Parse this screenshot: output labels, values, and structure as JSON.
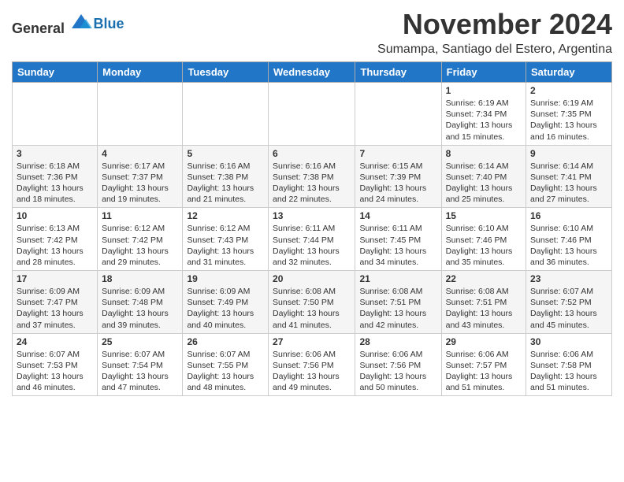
{
  "header": {
    "logo_general": "General",
    "logo_blue": "Blue",
    "month_title": "November 2024",
    "subtitle": "Sumampa, Santiago del Estero, Argentina"
  },
  "weekdays": [
    "Sunday",
    "Monday",
    "Tuesday",
    "Wednesday",
    "Thursday",
    "Friday",
    "Saturday"
  ],
  "weeks": [
    [
      {
        "day": "",
        "info": ""
      },
      {
        "day": "",
        "info": ""
      },
      {
        "day": "",
        "info": ""
      },
      {
        "day": "",
        "info": ""
      },
      {
        "day": "",
        "info": ""
      },
      {
        "day": "1",
        "info": "Sunrise: 6:19 AM\nSunset: 7:34 PM\nDaylight: 13 hours\nand 15 minutes."
      },
      {
        "day": "2",
        "info": "Sunrise: 6:19 AM\nSunset: 7:35 PM\nDaylight: 13 hours\nand 16 minutes."
      }
    ],
    [
      {
        "day": "3",
        "info": "Sunrise: 6:18 AM\nSunset: 7:36 PM\nDaylight: 13 hours\nand 18 minutes."
      },
      {
        "day": "4",
        "info": "Sunrise: 6:17 AM\nSunset: 7:37 PM\nDaylight: 13 hours\nand 19 minutes."
      },
      {
        "day": "5",
        "info": "Sunrise: 6:16 AM\nSunset: 7:38 PM\nDaylight: 13 hours\nand 21 minutes."
      },
      {
        "day": "6",
        "info": "Sunrise: 6:16 AM\nSunset: 7:38 PM\nDaylight: 13 hours\nand 22 minutes."
      },
      {
        "day": "7",
        "info": "Sunrise: 6:15 AM\nSunset: 7:39 PM\nDaylight: 13 hours\nand 24 minutes."
      },
      {
        "day": "8",
        "info": "Sunrise: 6:14 AM\nSunset: 7:40 PM\nDaylight: 13 hours\nand 25 minutes."
      },
      {
        "day": "9",
        "info": "Sunrise: 6:14 AM\nSunset: 7:41 PM\nDaylight: 13 hours\nand 27 minutes."
      }
    ],
    [
      {
        "day": "10",
        "info": "Sunrise: 6:13 AM\nSunset: 7:42 PM\nDaylight: 13 hours\nand 28 minutes."
      },
      {
        "day": "11",
        "info": "Sunrise: 6:12 AM\nSunset: 7:42 PM\nDaylight: 13 hours\nand 29 minutes."
      },
      {
        "day": "12",
        "info": "Sunrise: 6:12 AM\nSunset: 7:43 PM\nDaylight: 13 hours\nand 31 minutes."
      },
      {
        "day": "13",
        "info": "Sunrise: 6:11 AM\nSunset: 7:44 PM\nDaylight: 13 hours\nand 32 minutes."
      },
      {
        "day": "14",
        "info": "Sunrise: 6:11 AM\nSunset: 7:45 PM\nDaylight: 13 hours\nand 34 minutes."
      },
      {
        "day": "15",
        "info": "Sunrise: 6:10 AM\nSunset: 7:46 PM\nDaylight: 13 hours\nand 35 minutes."
      },
      {
        "day": "16",
        "info": "Sunrise: 6:10 AM\nSunset: 7:46 PM\nDaylight: 13 hours\nand 36 minutes."
      }
    ],
    [
      {
        "day": "17",
        "info": "Sunrise: 6:09 AM\nSunset: 7:47 PM\nDaylight: 13 hours\nand 37 minutes."
      },
      {
        "day": "18",
        "info": "Sunrise: 6:09 AM\nSunset: 7:48 PM\nDaylight: 13 hours\nand 39 minutes."
      },
      {
        "day": "19",
        "info": "Sunrise: 6:09 AM\nSunset: 7:49 PM\nDaylight: 13 hours\nand 40 minutes."
      },
      {
        "day": "20",
        "info": "Sunrise: 6:08 AM\nSunset: 7:50 PM\nDaylight: 13 hours\nand 41 minutes."
      },
      {
        "day": "21",
        "info": "Sunrise: 6:08 AM\nSunset: 7:51 PM\nDaylight: 13 hours\nand 42 minutes."
      },
      {
        "day": "22",
        "info": "Sunrise: 6:08 AM\nSunset: 7:51 PM\nDaylight: 13 hours\nand 43 minutes."
      },
      {
        "day": "23",
        "info": "Sunrise: 6:07 AM\nSunset: 7:52 PM\nDaylight: 13 hours\nand 45 minutes."
      }
    ],
    [
      {
        "day": "24",
        "info": "Sunrise: 6:07 AM\nSunset: 7:53 PM\nDaylight: 13 hours\nand 46 minutes."
      },
      {
        "day": "25",
        "info": "Sunrise: 6:07 AM\nSunset: 7:54 PM\nDaylight: 13 hours\nand 47 minutes."
      },
      {
        "day": "26",
        "info": "Sunrise: 6:07 AM\nSunset: 7:55 PM\nDaylight: 13 hours\nand 48 minutes."
      },
      {
        "day": "27",
        "info": "Sunrise: 6:06 AM\nSunset: 7:56 PM\nDaylight: 13 hours\nand 49 minutes."
      },
      {
        "day": "28",
        "info": "Sunrise: 6:06 AM\nSunset: 7:56 PM\nDaylight: 13 hours\nand 50 minutes."
      },
      {
        "day": "29",
        "info": "Sunrise: 6:06 AM\nSunset: 7:57 PM\nDaylight: 13 hours\nand 51 minutes."
      },
      {
        "day": "30",
        "info": "Sunrise: 6:06 AM\nSunset: 7:58 PM\nDaylight: 13 hours\nand 51 minutes."
      }
    ]
  ]
}
